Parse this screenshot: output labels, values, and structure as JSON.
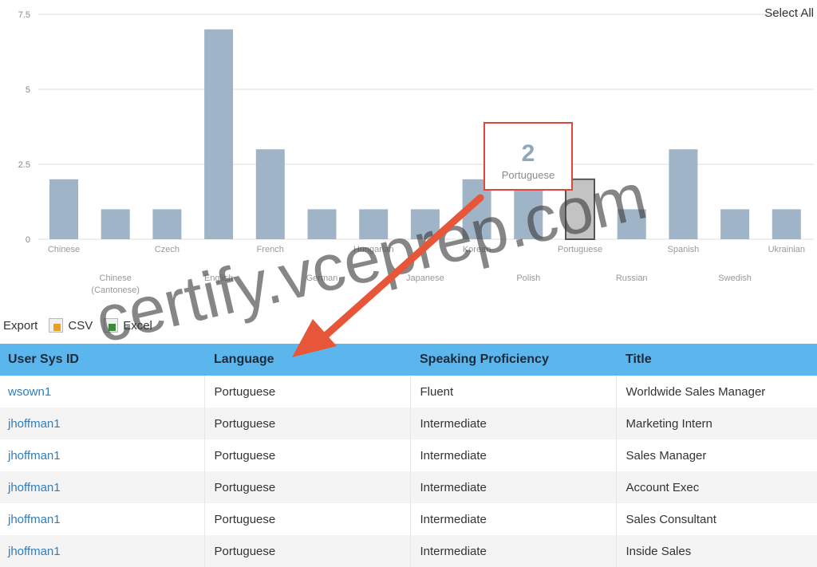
{
  "select_all_label": "Select All",
  "chart_data": {
    "type": "bar",
    "categories": [
      "Chinese",
      "Chinese (Cantonese)",
      "Czech",
      "English",
      "French",
      "German",
      "Hungarian",
      "Japanese",
      "Korean",
      "Polish",
      "Portuguese",
      "Russian",
      "Spanish",
      "Swedish",
      "Ukrainian"
    ],
    "values": [
      2,
      1,
      1,
      7,
      3,
      1,
      1,
      1,
      2,
      2,
      2,
      1,
      3,
      1,
      1
    ],
    "ylim": [
      0,
      7.5
    ],
    "yticks": [
      "0",
      "2.5",
      "5",
      "7.5"
    ],
    "selected_category": "Portuguese",
    "grid": true,
    "colors": {
      "bar": "#a0b4c8",
      "selected_bar": "#c3c3c3",
      "selected_outline": "#555555"
    },
    "tooltip": {
      "value": "2",
      "label": "Portuguese",
      "border_color": "#e0463a"
    }
  },
  "export": {
    "label": "Export",
    "csv_label": "CSV",
    "excel_label": "Excel"
  },
  "table": {
    "columns": [
      "User Sys ID",
      "Language",
      "Speaking Proficiency",
      "Title"
    ],
    "rows": [
      [
        "wsown1",
        "Portuguese",
        "Fluent",
        "Worldwide Sales Manager"
      ],
      [
        "jhoffman1",
        "Portuguese",
        "Intermediate",
        "Marketing Intern"
      ],
      [
        "jhoffman1",
        "Portuguese",
        "Intermediate",
        "Sales Manager"
      ],
      [
        "jhoffman1",
        "Portuguese",
        "Intermediate",
        "Account Exec"
      ],
      [
        "jhoffman1",
        "Portuguese",
        "Intermediate",
        "Sales Consultant"
      ],
      [
        "jhoffman1",
        "Portuguese",
        "Intermediate",
        "Inside Sales"
      ]
    ],
    "header_color": "#5bb6ee",
    "link_color": "#2f7ec0"
  },
  "watermark": {
    "text": "certify.vceprep.com",
    "arrow_color": "#e8563a"
  }
}
